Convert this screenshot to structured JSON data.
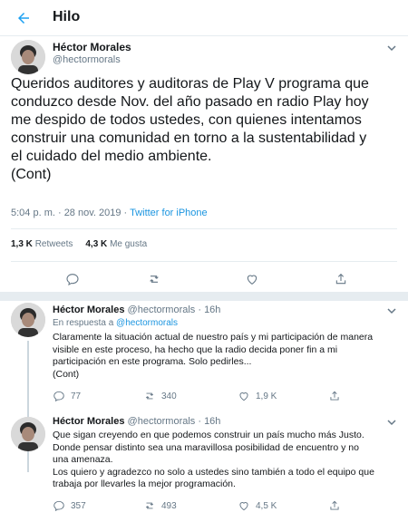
{
  "header": {
    "title": "Hilo",
    "back_icon": "arrow-left-icon"
  },
  "main_tweet": {
    "name": "Héctor Morales",
    "handle": "@hectormorals",
    "text": "Queridos auditores y auditoras de Play V programa que\nconduzco desde Nov. del año pasado en radio Play hoy\nme despido de todos ustedes, con quienes intentamos\nconstruir una comunidad en torno a la sustentabilidad y\nel cuidado del medio ambiente.\n(Cont)",
    "time": "5:04 p. m. · 28 nov. 2019 · ",
    "source": "Twitter for iPhone",
    "retweets_count": "1,3 K",
    "retweets_label": "Retweets",
    "likes_count": "4,3 K",
    "likes_label": "Me gusta"
  },
  "replies": [
    {
      "name": "Héctor Morales",
      "meta": "@hectormorals · 16h",
      "reply_prefix": "En respuesta a ",
      "reply_handle": "@hectormorals",
      "text": "Claramente la situación actual de nuestro país y mi participación de manera\nvisible en este proceso, ha hecho que la radio decida poner fin a mi\nparticipación en este programa. Solo pedirles...\n(Cont)",
      "replies": "77",
      "retweets": "340",
      "likes": "1,9 K"
    },
    {
      "name": "Héctor Morales",
      "meta": "@hectormorals · 16h",
      "text": "Que sigan creyendo en que podemos construir un país mucho más Justo.\nDonde pensar distinto sea una maravillosa posibilidad de encuentro y no\nuna amenaza.\nLos quiero y agradezco no solo a ustedes sino también a todo el equipo que\ntrabaja por llevarles la mejor programación.",
      "replies": "357",
      "retweets": "493",
      "likes": "4,5 K"
    }
  ],
  "colors": {
    "accent": "#1da1f2",
    "link": "#1b95e0",
    "muted": "#657786",
    "border": "#e6ecf0"
  }
}
